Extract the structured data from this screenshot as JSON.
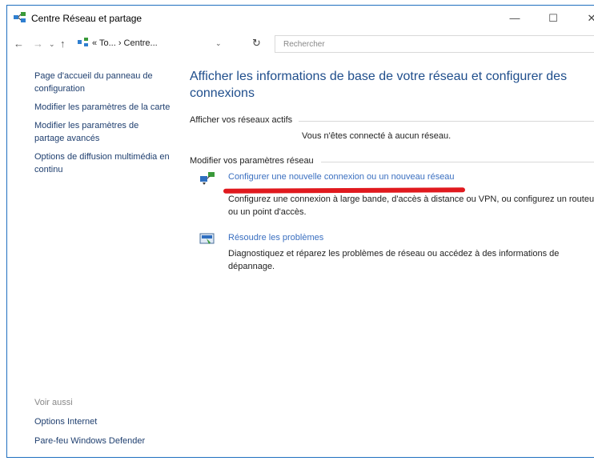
{
  "window": {
    "title": "Centre Réseau et partage",
    "minimize_label": "—",
    "maximize_label": "☐",
    "close_label": "✕"
  },
  "navbar": {
    "back_icon": "←",
    "forward_icon": "→",
    "history_icon": "⌄",
    "up_icon": "↑",
    "breadcrumb": "« To... › Centre...",
    "dropdown_icon": "⌄",
    "refresh_icon": "↻",
    "search_placeholder": "Rechercher"
  },
  "sidebar": {
    "items": [
      {
        "label": "Page d'accueil du panneau de configuration"
      },
      {
        "label": "Modifier les paramètres de la carte"
      },
      {
        "label": "Modifier les paramètres de partage avancés"
      },
      {
        "label": "Options de diffusion multimédia en continu"
      }
    ],
    "see_also": "Voir aussi",
    "bottom_links": [
      "Options Internet",
      "Pare-feu Windows Defender"
    ]
  },
  "main": {
    "title": "Afficher les informations de base de votre réseau et configurer des connexions",
    "active_networks_label": "Afficher vos réseaux actifs",
    "no_network_text": "Vous n'êtes connecté à aucun réseau.",
    "change_settings_label": "Modifier vos paramètres réseau",
    "tasks": [
      {
        "icon": "network-setup-icon",
        "link": "Configurer une nouvelle connexion ou un nouveau réseau",
        "description": "Configurez une connexion à large bande, d'accès à distance ou VPN, ou configurez un routeur ou un point d'accès."
      },
      {
        "icon": "troubleshoot-icon",
        "link": "Résoudre les problèmes",
        "description": "Diagnostiquez et réparez les problèmes de réseau ou accédez à des informations de dépannage."
      }
    ]
  },
  "colors": {
    "link": "#3a6fc0",
    "title": "#1f4e8c",
    "annotation": "#e0191e",
    "window_border": "#1f6fbf"
  }
}
